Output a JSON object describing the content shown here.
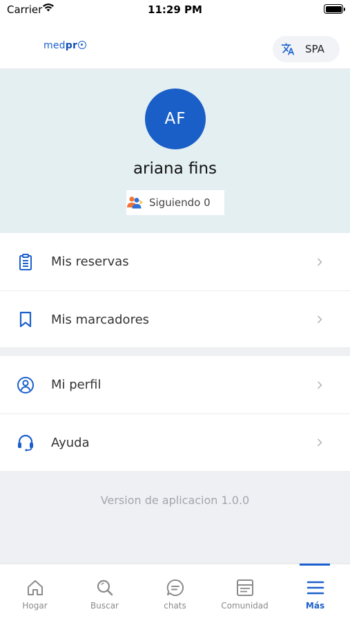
{
  "status_bar": {
    "carrier": "Carrier",
    "time": "11:29 PM"
  },
  "header": {
    "logo_prefix": "med",
    "logo_suffix": "pr",
    "language_label": "SPA",
    "icons": {
      "language": "translate-icon"
    }
  },
  "profile": {
    "initials": "AF",
    "name": "ariana fins",
    "following_label": "Siguiendo 0",
    "avatar_color": "#1a5fc7",
    "background_color": "#e4eff2"
  },
  "menu": {
    "group1": [
      {
        "label": "Mis reservas",
        "icon": "clipboard-icon"
      },
      {
        "label": "Mis marcadores",
        "icon": "bookmark-icon"
      }
    ],
    "group2": [
      {
        "label": "Mi perfil",
        "icon": "user-circle-icon"
      },
      {
        "label": "Ayuda",
        "icon": "headset-icon"
      }
    ]
  },
  "footer": {
    "version_text": "Version de aplicacion 1.0.0"
  },
  "tab_bar": {
    "active_color": "#1a5fcc",
    "tabs": [
      {
        "label": "Hogar",
        "icon": "home-icon"
      },
      {
        "label": "Buscar",
        "icon": "search-icon"
      },
      {
        "label": "chats",
        "icon": "chat-icon"
      },
      {
        "label": "Comunidad",
        "icon": "community-icon"
      },
      {
        "label": "Más",
        "icon": "menu-icon",
        "active": true
      }
    ]
  }
}
